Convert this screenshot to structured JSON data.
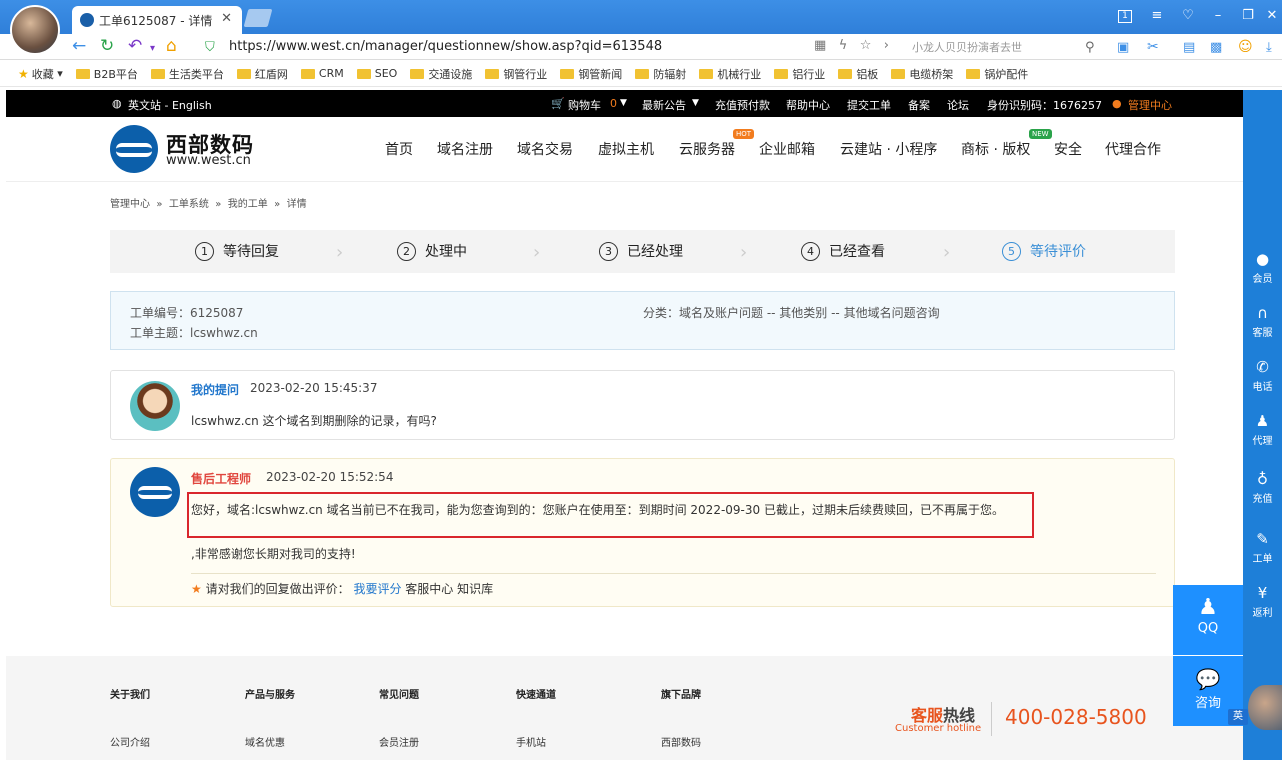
{
  "browser": {
    "tab_title": "工单6125087 - 详情",
    "tab_close": "✕",
    "url": "https://www.west.cn/manager/questionnew/show.asp?qid=613548",
    "search_placeholder": "小龙人贝贝扮演者去世",
    "bookmarks": [
      "收藏",
      "B2B平台",
      "生活类平台",
      "红盾网",
      "CRM",
      "SEO",
      "交通设施",
      "钢管行业",
      "钢管新闻",
      "防辐射",
      "机械行业",
      "铝行业",
      "铝板",
      "电缆桥架",
      "锅炉配件"
    ]
  },
  "topbar": {
    "lang": "英文站 - English",
    "cart": "购物车",
    "cart_count": "0",
    "notice": "最新公告",
    "recharge": "充值预付款",
    "help": "帮助中心",
    "submit_ticket": "提交工单",
    "record": "备案",
    "forum": "论坛",
    "id_code": "身份识别码：1676257",
    "manage": "管理中心"
  },
  "header": {
    "brand": "西部数码",
    "brand_sub": "www.west.cn",
    "menu": [
      "首页",
      "域名注册",
      "域名交易",
      "虚拟主机",
      "云服务器",
      "企业邮箱",
      "云建站 · 小程序",
      "商标 · 版权",
      "安全",
      "代理合作"
    ],
    "badge_hot": "HOT",
    "badge_new": "NEW"
  },
  "breadcrumb": [
    "管理中心",
    "工单系统",
    "我的工单",
    "详情"
  ],
  "steps": [
    {
      "num": "1",
      "label": "等待回复"
    },
    {
      "num": "2",
      "label": "处理中"
    },
    {
      "num": "3",
      "label": "已经处理"
    },
    {
      "num": "4",
      "label": "已经查看"
    },
    {
      "num": "5",
      "label": "等待评价"
    }
  ],
  "ticket": {
    "number": "工单编号：6125087",
    "subject": "工单主题：lcswhwz.cn",
    "category": "分类：域名及账户问题 -- 其他类别 -- 其他域名问题咨询"
  },
  "question": {
    "who": "我的提问",
    "time": "2023-02-20 15:45:37",
    "text": "lcswhwz.cn 这个域名到期删除的记录，有吗?"
  },
  "answer": {
    "who": "售后工程师",
    "time": "2023-02-20 15:52:54",
    "text": "您好，域名:lcswhwz.cn 域名当前已不在我司，能为您查询到的：您账户在使用至：到期时间 2022-09-30 已截止，过期未后续费赎回，已不再属于您。",
    "thanks": ",非常感谢您长期对我司的支持!",
    "rate_prompt": "请对我们的回复做出评价：",
    "rate_link": "我要评分",
    "service": "客服中心",
    "kb": "知识库"
  },
  "footer": {
    "headings": [
      "关于我们",
      "产品与服务",
      "常见问题",
      "快速通道",
      "旗下品牌"
    ],
    "links": [
      "公司介绍",
      "域名优惠",
      "会员注册",
      "手机站",
      "西部数码"
    ],
    "hotline_label": "客服热线",
    "hotline_label_accent": "客服",
    "hotline_label_rest": "热线",
    "hotline_en": "Customer hotline",
    "hotline_number": "400-028-5800"
  },
  "sidebar": [
    "会员",
    "客服",
    "电话",
    "代理",
    "充值",
    "工单",
    "返利"
  ],
  "float": {
    "qq": "QQ",
    "consult": "咨询",
    "lang_chip": "英"
  },
  "colors": {
    "accent_blue": "#1e7fd8",
    "brand_blue": "#0c5faa",
    "warn_red": "#d9262c",
    "orange": "#e8541e"
  }
}
